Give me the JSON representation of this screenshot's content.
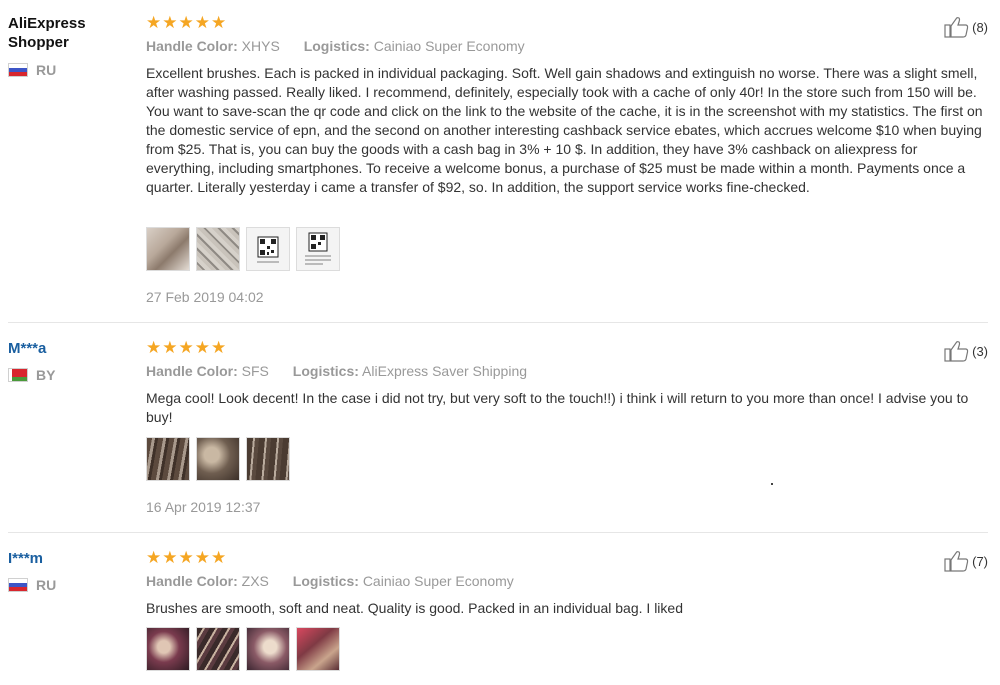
{
  "labels": {
    "handle_color": "Handle Color:",
    "logistics": "Logistics:",
    "star_glyph": "★"
  },
  "reviews": [
    {
      "user": "AliExpress Shopper",
      "country": "RU",
      "rating": 5,
      "handle_color": "XHYS",
      "logistics": "Cainiao Super Economy",
      "helpful_count": "(8)",
      "text": "Excellent brushes. Each is packed in individual packaging. Soft. Well gain shadows and extinguish no worse. There was a slight smell, after washing passed. Really liked. I recommend, definitely, especially took with a cache of only 40r! In the store such from 150 will be. You want to save-scan the qr code and click on the link to the website of the cache, it is in the screenshot with my statistics. The first on the domestic service of epn, and the second on another interesting cashback service ebates, which accrues welcome $10 when buying from $25. That is, you can buy the goods with a cash bag in 3% + 10 $. In addition, they have 3% cashback on aliexpress for everything, including smartphones. To receive a welcome bonus, a purchase of $25 must be made within a month. Payments once a quarter. Literally yesterday i came a transfer of $92, so. In addition, the support service works fine-checked.",
      "date": "27 Feb 2019 04:02"
    },
    {
      "user": "M***a",
      "country": "BY",
      "rating": 5,
      "handle_color": "SFS",
      "logistics": "AliExpress Saver Shipping",
      "helpful_count": "(3)",
      "text": "Mega cool! Look decent! In the case i did not try, but very soft to the touch!!) i think i will return to you more than once! I advise you to buy!",
      "date": "16 Apr 2019 12:37"
    },
    {
      "user": "I***m",
      "country": "RU",
      "rating": 5,
      "handle_color": "ZXS",
      "logistics": "Cainiao Super Economy",
      "helpful_count": "(7)",
      "text": "Brushes are smooth, soft and neat. Quality is good. Packed in an individual bag. I liked",
      "date": ""
    }
  ]
}
